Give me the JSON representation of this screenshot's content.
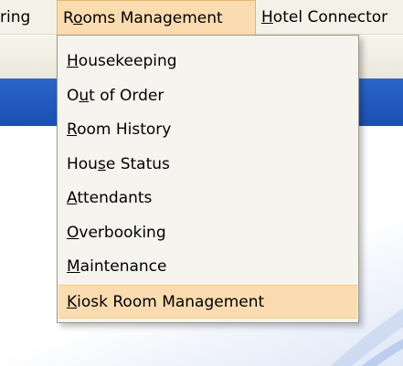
{
  "menubar": {
    "items": [
      {
        "pre": "",
        "ul": "",
        "post": "ring"
      },
      {
        "pre": "R",
        "ul": "o",
        "post": "oms Management"
      },
      {
        "pre": "",
        "ul": "H",
        "post": "otel Connector"
      }
    ],
    "active_index": 1
  },
  "dropdown": {
    "items": [
      {
        "pre": "",
        "ul": "H",
        "post": "ousekeeping"
      },
      {
        "pre": "O",
        "ul": "u",
        "post": "t of Order"
      },
      {
        "pre": "",
        "ul": "R",
        "post": "oom History"
      },
      {
        "pre": "Hou",
        "ul": "s",
        "post": "e Status"
      },
      {
        "pre": "",
        "ul": "A",
        "post": "ttendants"
      },
      {
        "pre": "",
        "ul": "O",
        "post": "verbooking"
      },
      {
        "pre": "",
        "ul": "M",
        "post": "aintenance"
      },
      {
        "pre": "",
        "ul": "K",
        "post": "iosk Room Management"
      }
    ],
    "highlighted_index": 7
  },
  "colors": {
    "menu_highlight": "#fbdcb0",
    "menu_background": "#f6f4ee",
    "blue_band": "#1b4fb2"
  }
}
